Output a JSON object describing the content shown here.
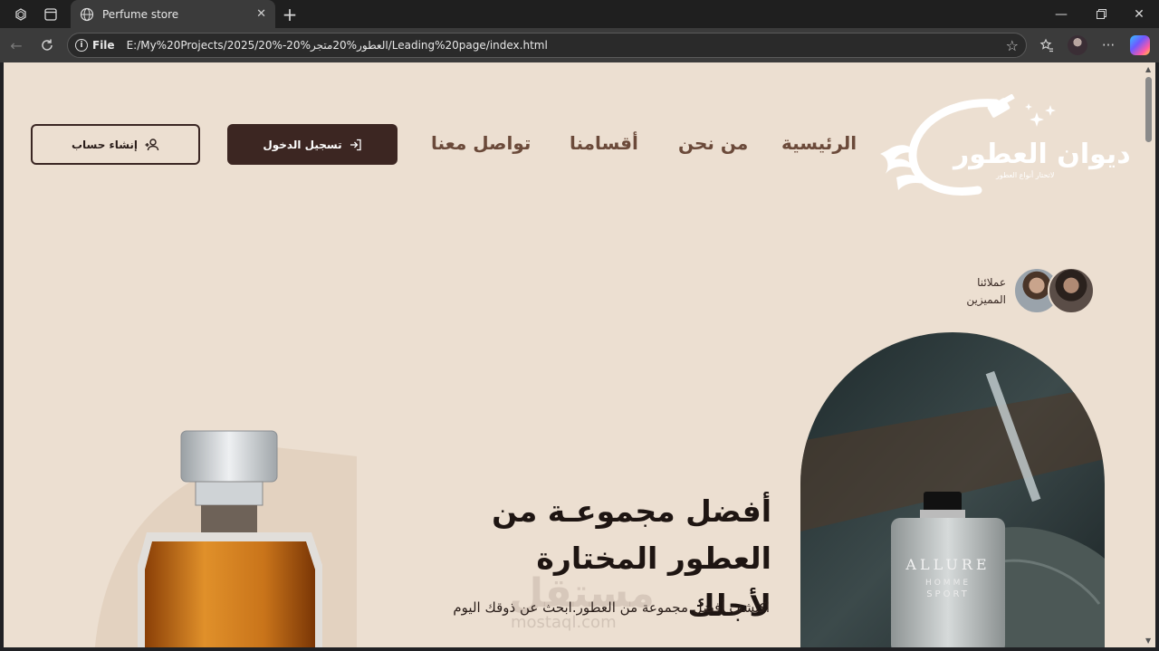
{
  "browser": {
    "tab_title": "Perfume store",
    "file_label": "File",
    "url": "E:/My%20Projects/2025/20%-20%العطور%20متجر/Leading%20page/index.html"
  },
  "site": {
    "logo_title": "ديوان العطور",
    "logo_subtitle": "لاتحتار أنواع العطور",
    "nav": [
      "الرئيسية",
      "من نحن",
      "أقسامنا",
      "تواصل معنا"
    ],
    "login_label": "تسجيل الدخول",
    "signup_label": "إنشاء حساب",
    "clients_label": "عملائنا المميزين",
    "hero_title": "أفضل مجموعـة من العطور المختارة لأجلك",
    "hero_desc": "اكتشف أفضل مجموعة من العطور.ابحث عن ذوقك اليوم",
    "product_label_1": "ALLURE",
    "product_label_2": "HOMME",
    "product_label_3": "SPORT",
    "watermark": "مستقل",
    "watermark_sub": "mostaql.com"
  },
  "colors": {
    "page_bg": "#ecdfd1",
    "brand_dark": "#3c2622",
    "nav_text": "#6b4a3a"
  }
}
